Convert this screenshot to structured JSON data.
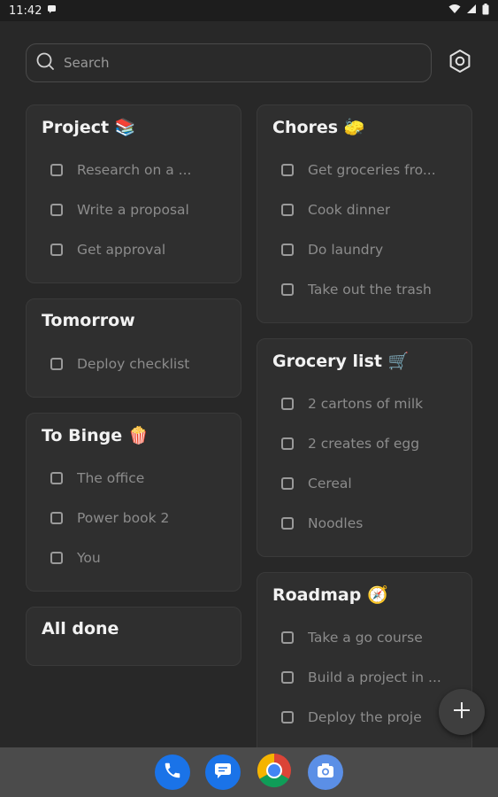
{
  "status_bar": {
    "time": "11:42",
    "icons": [
      "notification-icon",
      "wifi-icon",
      "signal-icon",
      "battery-icon"
    ]
  },
  "search": {
    "placeholder": "Search",
    "icon": "search-icon"
  },
  "settings_icon": "gear-icon",
  "columns": {
    "left": [
      {
        "title": "Project 📚",
        "items": [
          "Research on a ...",
          "Write a proposal",
          "Get approval"
        ]
      },
      {
        "title": "Tomorrow",
        "items": [
          "Deploy checklist"
        ]
      },
      {
        "title": "To Binge 🍿",
        "items": [
          "The office",
          "Power book 2",
          "You"
        ]
      },
      {
        "title": "All done",
        "items": []
      }
    ],
    "right": [
      {
        "title": "Chores 🧽",
        "items": [
          "Get groceries fro...",
          "Cook dinner",
          "Do laundry",
          "Take out the trash"
        ]
      },
      {
        "title": "Grocery list 🛒",
        "items": [
          "2 cartons of milk",
          "2 creates of egg",
          "Cereal",
          "Noodles"
        ]
      },
      {
        "title": "Roadmap 🧭",
        "items": [
          "Take a go course",
          "Build a project in ...",
          "Deploy the proje"
        ]
      }
    ]
  },
  "fab": {
    "icon": "plus-icon"
  },
  "dock": {
    "apps": [
      "phone-icon",
      "messages-icon",
      "chrome-icon",
      "camera-icon"
    ]
  },
  "colors": {
    "background": "#282828",
    "card": "#2f2f2f",
    "dock": "#4b4b4b",
    "phone_blue": "#1a73e8"
  }
}
